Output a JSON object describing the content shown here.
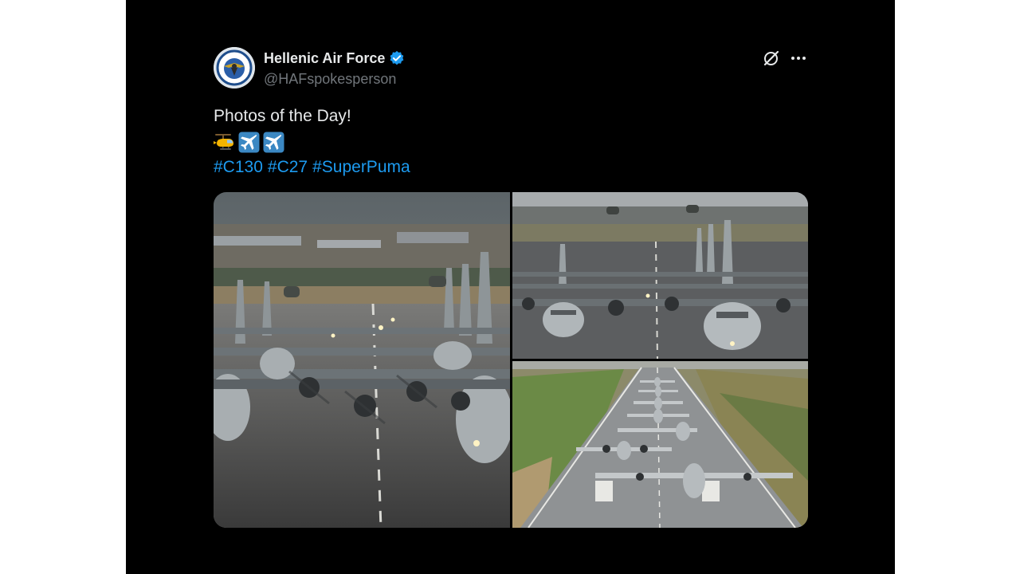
{
  "author": {
    "name": "Hellenic Air Force",
    "handle": "@HAFspokesperson",
    "avatar_icon": "air-force-emblem-icon",
    "verified_icon": "verified-badge-icon",
    "verified_color": "#1d9bf0"
  },
  "actions": {
    "grok_icon": "grok-icon",
    "more_icon": "more-options-icon"
  },
  "tweet": {
    "text": "Photos of the Day!",
    "emojis": [
      "helicopter-emoji",
      "airplane-emoji",
      "airplane-emoji"
    ],
    "hashtags": [
      "#C130",
      "#C27",
      "#SuperPuma"
    ]
  },
  "media": {
    "photos": [
      {
        "description_icon": "aircraft-lineup-photo-icon"
      },
      {
        "description_icon": "aircraft-taxi-photo-icon"
      },
      {
        "description_icon": "runway-aerial-photo-icon"
      }
    ]
  },
  "colors": {
    "background": "#000000",
    "text": "#e7e9ea",
    "secondary_text": "#71767b",
    "link": "#1d9bf0"
  }
}
